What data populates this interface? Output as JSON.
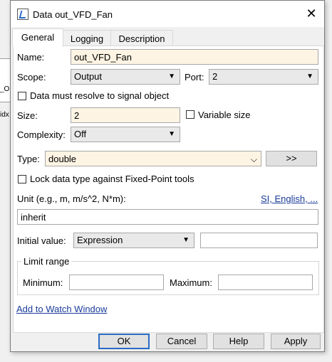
{
  "background": {
    "left_labels": [
      "_Or",
      "idx"
    ]
  },
  "window": {
    "title": "Data out_VFD_Fan",
    "close_glyph": "✕"
  },
  "tabs": [
    {
      "label": "General",
      "active": true
    },
    {
      "label": "Logging",
      "active": false
    },
    {
      "label": "Description",
      "active": false
    }
  ],
  "general": {
    "name_label": "Name:",
    "name_value": "out_VFD_Fan",
    "scope_label": "Scope:",
    "scope_value": "Output",
    "port_label": "Port:",
    "port_value": "2",
    "resolve_label": "Data must resolve to signal object",
    "resolve_checked": false,
    "size_label": "Size:",
    "size_value": "2",
    "variable_size_label": "Variable size",
    "variable_size_checked": false,
    "complexity_label": "Complexity:",
    "complexity_value": "Off",
    "type_label": "Type:",
    "type_value": "double",
    "type_assistant_label": ">>",
    "lock_label": "Lock data type against Fixed-Point tools",
    "lock_checked": false,
    "unit_label": "Unit (e.g., m, m/s^2, N*m):",
    "unit_link": "SI, English, ...",
    "unit_value": "inherit",
    "initial_label": "Initial value:",
    "initial_mode": "Expression",
    "initial_value": "",
    "limit_range_title": "Limit range",
    "minimum_label": "Minimum:",
    "minimum_value": "",
    "maximum_label": "Maximum:",
    "maximum_value": "",
    "watch_link": "Add to Watch Window"
  },
  "buttons": {
    "ok": "OK",
    "cancel": "Cancel",
    "help": "Help",
    "apply": "Apply"
  },
  "colors": {
    "cream_field": "#fef4e4",
    "link": "#1a3b9a",
    "default_button_border": "#2a6bc4"
  }
}
